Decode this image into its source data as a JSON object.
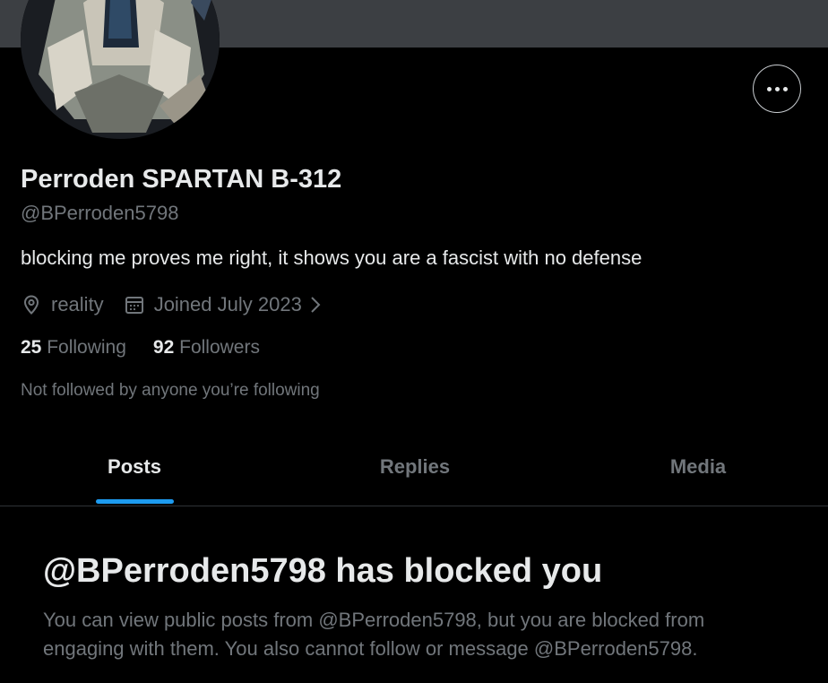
{
  "profile": {
    "display_name": "Perroden SPARTAN B-312",
    "handle": "@BPerroden5798",
    "bio": "blocking me proves me right, it shows you are a fascist with no defense",
    "location": "reality",
    "joined": "Joined July 2023",
    "location_icon": "location-pin-icon",
    "calendar_icon": "calendar-icon",
    "more_icon": "more-options-icon"
  },
  "stats": {
    "following_count": "25",
    "following_label": "Following",
    "followers_count": "92",
    "followers_label": "Followers"
  },
  "not_followed_text": "Not followed by anyone you’re following",
  "tabs": [
    {
      "label": "Posts",
      "active": true
    },
    {
      "label": "Replies",
      "active": false
    },
    {
      "label": "Media",
      "active": false
    }
  ],
  "blocked_notice": {
    "title": "@BPerroden5798 has blocked you",
    "description": "You can view public posts from @BPerroden5798, but you are blocked from engaging with them. You also cannot follow or message @BPerroden5798."
  },
  "colors": {
    "background": "#000000",
    "banner": "#3c3f43",
    "text_primary": "#e7e9ea",
    "text_secondary": "#71767b",
    "accent": "#1d9bf0",
    "divider": "#2f3336"
  }
}
